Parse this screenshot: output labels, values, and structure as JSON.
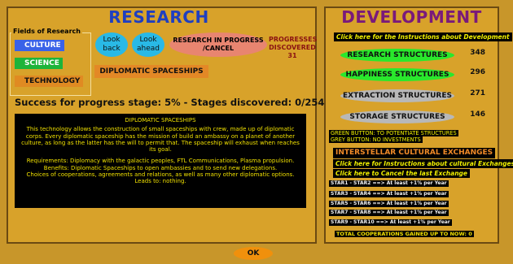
{
  "research": {
    "title": "RESEARCH",
    "fields_label": "Fields of Research",
    "fields": [
      {
        "label": "CULTURE",
        "color": "#3a62e8",
        "text_color": "#ffffff",
        "selected": false
      },
      {
        "label": "SCIENCE",
        "color": "#1db43a",
        "text_color": "#ffffff",
        "selected": false
      },
      {
        "label": "TECHNOLOGY",
        "color": "#e08a22",
        "text_color": "#111111",
        "selected": true
      }
    ],
    "look_back": "Look back",
    "look_ahead": "Look ahead",
    "research_in_progress": "RESEARCH IN PROGRESS /CANCEL",
    "progresses_label": "PROGRESSES DISCOVERED",
    "progresses_value": "31",
    "selected_item": "DIPLOMATIC SPACESHIPS",
    "success_text": "Success for progress stage: 5% - Stages discovered: 0/254",
    "description": {
      "heading": "DIPLOMATIC SPACESHIPS",
      "body": "This technology allows the construction of small spaceships with crew, made up of diplomatic corps. Every diplomatic spaceship has the mission of build an ambassy on a planet of another culture, as long as the latter has the will to permit that. The spaceship will exhaust when reaches its goal.",
      "requirements": "Requirements: Diplomacy with the galactic peoples, FTL Communications, Plasma propulsion.",
      "benefits": "Benefits: Diplomatic Spaceships to open ambassies and to send new delegations.",
      "choices": "Choices of cooperations, agreements and relations, as well as many other diplomatic options.",
      "leads": "Leads to: nothing."
    }
  },
  "development": {
    "title": "DEVELOPMENT",
    "instructions_link": "Click here for the Instructions about Development",
    "structures": [
      {
        "label": "RESEARCH STRUCTURES",
        "value": "348",
        "state": "green"
      },
      {
        "label": "HAPPINESS STRUCTURES",
        "value": "296",
        "state": "green"
      },
      {
        "label": "EXTRACTION STRUCTURES",
        "value": "271",
        "state": "grey"
      },
      {
        "label": "STORAGE STRUCTURES",
        "value": "146",
        "state": "grey"
      }
    ],
    "note_green": "GREEN BUTTON: TO POTENTIATE STRUCTURES",
    "note_grey": "GREY BUTTON: NO INVESTMENTS",
    "exchanges_title": "INTERSTELLAR CULTURAL EXCHANGES",
    "exchanges_instructions": "Click here for Instructions about cultural Exchanges",
    "cancel_last": "Click here to Cancel the last Exchange",
    "stars": [
      "STAR1 - STAR2 ==> At least +1% per Year",
      "STAR3 - STAR4 ==> At least +1% per Year",
      "STAR5 - STAR6 ==> At least +1% per Year",
      "STAR7 - STAR8 ==> At least +1% per Year",
      "STAR9 - STAR10 ==> At least +1% per Year"
    ],
    "total_cooperations": "TOTAL COOPERATIONS GAINED UP TO NOW: 0"
  },
  "ok_label": "OK"
}
